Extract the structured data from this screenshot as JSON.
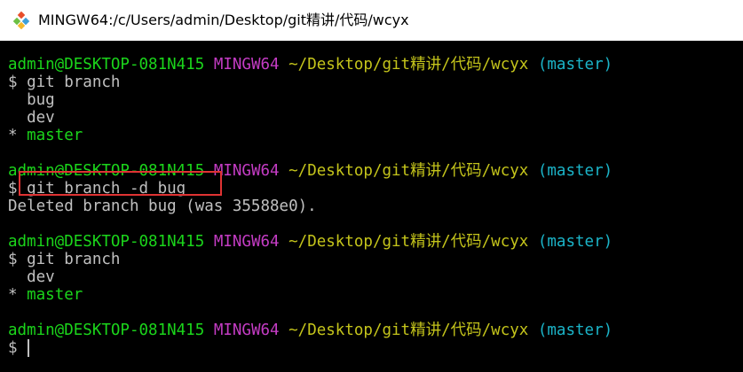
{
  "window": {
    "title": "MINGW64:/c/Users/admin/Desktop/git精讲/代码/wcyx",
    "icon": "git-bash-icon"
  },
  "colors": {
    "user": "#1bd51b",
    "system": "#c43cc4",
    "path": "#c4c41b",
    "branch": "#1bb4c8",
    "text": "#c0c0c0",
    "highlight": "#e03333"
  },
  "terminal": {
    "prompts": [
      {
        "user": "admin@DESKTOP-081N415",
        "system": "MINGW64",
        "path": "~/Desktop/git精讲/代码/wcyx",
        "branch": "(master)"
      },
      {
        "user": "admin@DESKTOP-081N415",
        "system": "MINGW64",
        "path": "~/Desktop/git精讲/代码/wcyx",
        "branch": "(master)"
      },
      {
        "user": "admin@DESKTOP-081N415",
        "system": "MINGW64",
        "path": "~/Desktop/git精讲/代码/wcyx",
        "branch": "(master)"
      },
      {
        "user": "admin@DESKTOP-081N415",
        "system": "MINGW64",
        "path": "~/Desktop/git精讲/代码/wcyx",
        "branch": "(master)"
      }
    ],
    "dollar": "$",
    "cmd1": "git branch",
    "out1": [
      "  bug",
      "  dev"
    ],
    "current_marker": "*",
    "current_branch": "master",
    "cmd2": "git branch -d bug",
    "out2": "Deleted branch bug (was 35588e0).",
    "cmd3": "git branch",
    "out3": [
      "  dev"
    ]
  }
}
